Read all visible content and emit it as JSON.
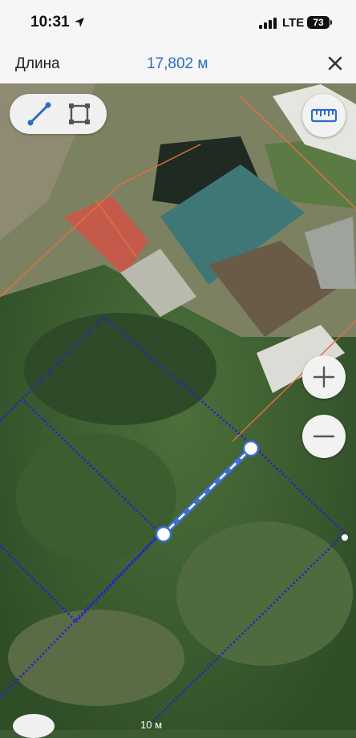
{
  "status_bar": {
    "time": "10:31",
    "network": "LTE",
    "battery": "73"
  },
  "header": {
    "title": "Длина",
    "measurement": "17,802 м",
    "close_icon": "close-icon"
  },
  "toolbar": {
    "tools": [
      {
        "name": "line-tool",
        "icon": "line-icon"
      },
      {
        "name": "area-tool",
        "icon": "square-icon"
      }
    ],
    "ruler_icon": "ruler-icon"
  },
  "zoom": {
    "in_icon": "plus-icon",
    "out_icon": "minus-icon"
  },
  "map": {
    "scale_label": "10 м",
    "colors": {
      "parcel_border": "#2a1fd0",
      "measure_line": "#3d6fd6",
      "boundary_line": "#e07040"
    }
  }
}
